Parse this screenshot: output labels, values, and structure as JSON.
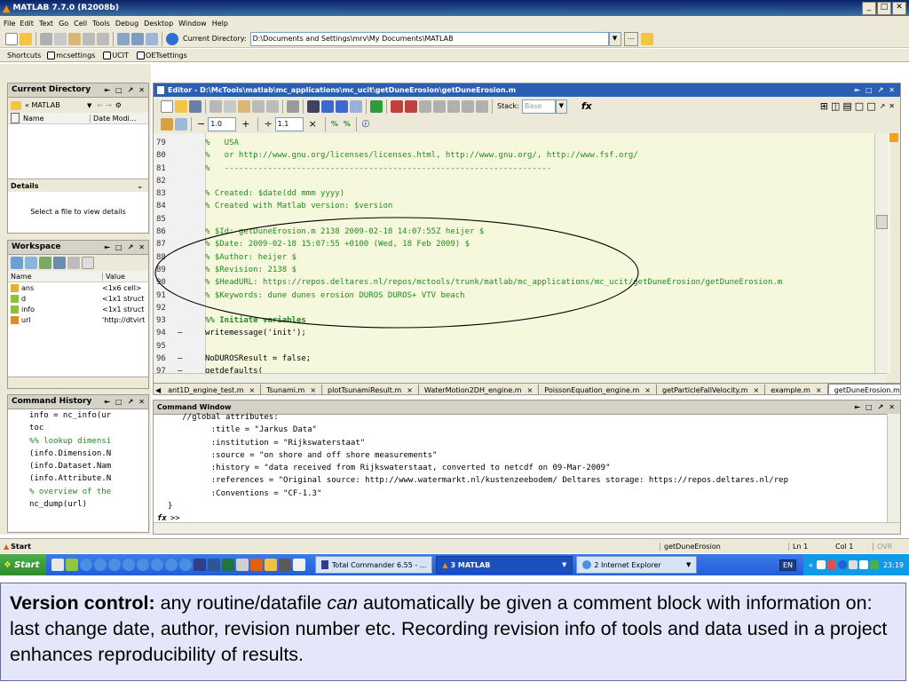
{
  "window": {
    "title": "MATLAB  7.7.0 (R2008b)",
    "controls": [
      "_",
      "□",
      "✕"
    ]
  },
  "menu": [
    "File",
    "Edit",
    "Text",
    "Go",
    "Cell",
    "Tools",
    "Debug",
    "Desktop",
    "Window",
    "Help"
  ],
  "toolbar": {
    "current_dir_label": "Current Directory:",
    "current_dir_value": "D:\\Documents and Settings\\mrv\\My Documents\\MATLAB",
    "browse_label": "..."
  },
  "shortcuts": {
    "label": "Shortcuts",
    "items": [
      "mcsettings",
      "UCIT",
      "OETsettings"
    ]
  },
  "current_directory": {
    "title": "Current Directory",
    "path": "« MATLAB",
    "col_name": "Name",
    "col_date": "Date Modi...",
    "details_title": "Details",
    "details_text": "Select a file to view details"
  },
  "workspace": {
    "title": "Workspace",
    "col_name": "Name",
    "col_value": "Value",
    "rows": [
      {
        "name": "ans",
        "value": "<1x6 cell>"
      },
      {
        "name": "d",
        "value": "<1x1 struct"
      },
      {
        "name": "info",
        "value": "<1x1 struct"
      },
      {
        "name": "url",
        "value": "'http://dtvirt"
      }
    ]
  },
  "command_history": {
    "title": "Command History",
    "lines": [
      "info = nc_info(ur",
      "toc",
      "%% lookup dimensi",
      "(info.Dimension.N",
      "(info.Dataset.Nam",
      "(info.Attribute.N",
      "% overview of the",
      "nc_dump(url)"
    ]
  },
  "editor": {
    "title": "Editor - D:\\McTools\\matlab\\mc_applications\\mc_ucit\\getDuneErosion\\getDuneErosion.m",
    "stack_label": "Stack:",
    "stack_value": "Base",
    "fx_label": "fx",
    "cell_size_1": "1.0",
    "cell_size_2": "1.1",
    "lines": [
      {
        "num": "79",
        "dash": "",
        "text": "%   USA",
        "type": "comment"
      },
      {
        "num": "80",
        "dash": "",
        "text": "%   or http://www.gnu.org/licenses/licenses.html, http://www.gnu.org/, http://www.fsf.org/",
        "type": "comment"
      },
      {
        "num": "81",
        "dash": "",
        "text": "%   --------------------------------------------------------------------",
        "type": "comment"
      },
      {
        "num": "82",
        "dash": "",
        "text": "",
        "type": "code"
      },
      {
        "num": "83",
        "dash": "",
        "text": "% Created: $date(dd mmm yyyy)",
        "type": "comment"
      },
      {
        "num": "84",
        "dash": "",
        "text": "% Created with Matlab version: $version",
        "type": "comment"
      },
      {
        "num": "85",
        "dash": "",
        "text": "",
        "type": "code"
      },
      {
        "num": "86",
        "dash": "",
        "text": "% $Id: getDuneErosion.m 2138 2009-02-18 14:07:55Z heijer $",
        "type": "comment"
      },
      {
        "num": "87",
        "dash": "",
        "text": "% $Date: 2009-02-18 15:07:55 +0100 (Wed, 18 Feb 2009) $",
        "type": "comment"
      },
      {
        "num": "88",
        "dash": "",
        "text": "% $Author: heijer $",
        "type": "comment"
      },
      {
        "num": "89",
        "dash": "",
        "text": "% $Revision: 2138 $",
        "type": "comment"
      },
      {
        "num": "90",
        "dash": "",
        "text": "% $HeadURL: https://repos.deltares.nl/repos/mctools/trunk/matlab/mc_applications/mc_ucit/getDuneErosion/getDuneErosion.m",
        "type": "comment"
      },
      {
        "num": "91",
        "dash": "",
        "text": "% $Keywords: dune dunes erosion DUROS DUROS+ VTV beach",
        "type": "comment"
      },
      {
        "num": "92",
        "dash": "",
        "text": "",
        "type": "code"
      },
      {
        "num": "93",
        "dash": "",
        "text": "%% Initiate variables",
        "type": "cell"
      },
      {
        "num": "94",
        "dash": "–",
        "text": "writemessage('init');",
        "type": "code"
      },
      {
        "num": "95",
        "dash": "",
        "text": "",
        "type": "code"
      },
      {
        "num": "96",
        "dash": "–",
        "text": "NoDUROSResult = false;",
        "type": "code"
      },
      {
        "num": "97",
        "dash": "–",
        "text": "getdefaults(",
        "type": "code"
      }
    ],
    "tabs": [
      "ant1D_engine_test.m",
      "Tsunami.m",
      "plotTsunamiResult.m",
      "WaterMotion2DH_engine.m",
      "PoissonEquation_engine.m",
      "getParticleFallVelocity.m",
      "example.m",
      "getDuneErosion.m"
    ]
  },
  "command_window": {
    "title": "Command Window",
    "lines": [
      "   //global attributes:",
      "         :title = \"Jarkus Data\"",
      "         :institution = \"Rijkswaterstaat\"",
      "         :source = \"on shore and off shore measurements\"",
      "         :history = \"data received from Rijkswaterstaat, converted to netcdf on 09-Mar-2009\"",
      "         :references = \"Original source: http://www.watermarkt.nl/kustenzeebodem/ Deltares storage: https://repos.deltares.nl/rep",
      "         :Conventions = \"CF-1.3\"",
      "}"
    ],
    "prompt": ">>"
  },
  "statusbar": {
    "start": "Start",
    "function": "getDuneErosion",
    "ln": "Ln  1",
    "col": "Col  1",
    "ovr": "OVR"
  },
  "taskbar": {
    "start": "Start",
    "items": [
      "Total Commander 6.55 - ...",
      "3 MATLAB",
      "2 Internet Explorer"
    ],
    "lang": "EN",
    "time": "23:19"
  },
  "caption": {
    "bold": "Version control:",
    "pre": " any routine/datafile ",
    "italic": "can",
    "post": " automatically be given a comment block with information on: last change date, author, revision number etc. Recording revision info of tools and data used in a project enhances reproducibility of results."
  },
  "colors": {
    "comment": "#228b22",
    "titlebar": "#0a246a",
    "taskbar": "#245edb",
    "caption_bg": "#e6e6fa",
    "editor_bg": "#f5f8dc"
  }
}
